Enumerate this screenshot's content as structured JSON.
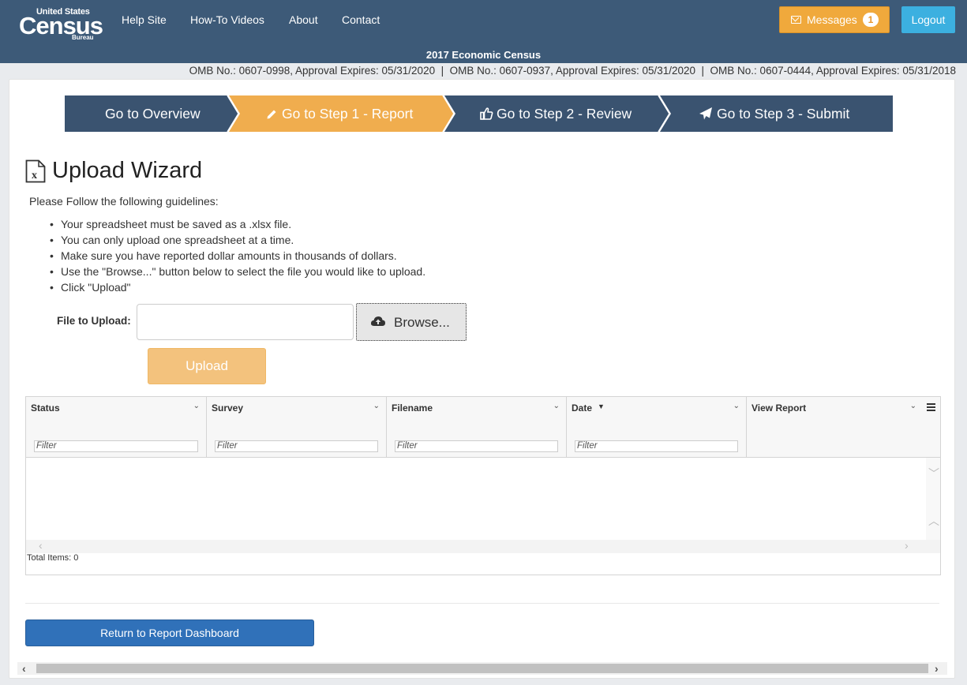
{
  "header": {
    "logo": {
      "line1": "United States",
      "line2": "Census",
      "line3": "Bureau"
    },
    "nav": [
      "Help Site",
      "How-To Videos",
      "About",
      "Contact"
    ],
    "messages_label": "Messages",
    "messages_count": "1",
    "logout_label": "Logout",
    "census_title": "2017 Economic Census",
    "omb_text": "OMB No.: 0607-0998, Approval Expires: 05/31/2020  |  OMB No.: 0607-0937, Approval Expires: 05/31/2020  |  OMB No.: 0607-0444, Approval Expires: 05/31/2018"
  },
  "steps": [
    {
      "label": "Go to Overview",
      "icon": "none",
      "active": false
    },
    {
      "label": "Go to Step 1 - Report",
      "icon": "pencil-icon",
      "active": true
    },
    {
      "label": "Go to Step 2 - Review",
      "icon": "thumbs-up-icon",
      "active": false
    },
    {
      "label": "Go to Step 3 - Submit",
      "icon": "paper-plane-icon",
      "active": false
    }
  ],
  "wizard": {
    "title": "Upload Wizard",
    "intro": "Please Follow the following guidelines:",
    "guidelines": [
      "Your spreadsheet must be saved as a .xlsx file.",
      "You can only upload one spreadsheet at a time.",
      "Make sure you have reported dollar amounts in thousands of dollars.",
      "Use the \"Browse...\" button below to select the file you would like to upload.",
      "Click \"Upload\""
    ],
    "file_label": "File to Upload:",
    "file_value": "",
    "browse_label": "Browse...",
    "upload_label": "Upload"
  },
  "grid": {
    "columns": [
      {
        "header": "Status",
        "filter_placeholder": "Filter"
      },
      {
        "header": "Survey",
        "filter_placeholder": "Filter"
      },
      {
        "header": "Filename",
        "filter_placeholder": "Filter"
      },
      {
        "header": "Date",
        "filter_placeholder": "Filter",
        "sorted": "descending"
      },
      {
        "header": "View Report",
        "filter_placeholder": ""
      }
    ],
    "rows": [],
    "total_items": "Total Items: 0"
  },
  "footer": {
    "return_label": "Return to Report Dashboard"
  },
  "colors": {
    "header_bg": "#3d5a78",
    "step_dark": "#3a5370",
    "step_active": "#f0ad4e",
    "messages_btn": "#f0a93c",
    "logout_btn": "#3cb0e0",
    "return_btn": "#3071b9"
  }
}
